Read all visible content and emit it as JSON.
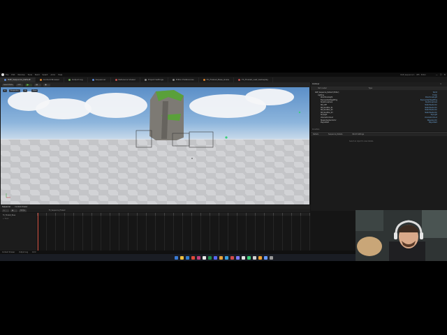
{
  "window": {
    "menu": [
      "File",
      "Edit",
      "Window",
      "Tools",
      "Build",
      "Select",
      "Actor",
      "Help"
    ],
    "title_right": "DAE_Sequence 1 · UE5 · Editor",
    "controls": [
      "—",
      "☐",
      "✕"
    ]
  },
  "tabs": [
    {
      "label": "DAE_Sequence_Default",
      "icon": "level-icon",
      "color": "#5c8ad8",
      "active": true
    },
    {
      "label": "Content Browser",
      "icon": "folder-icon",
      "color": "#d9822b",
      "active": false
    },
    {
      "label": "Output Log",
      "icon": "log-icon",
      "color": "#6aa84f",
      "active": false
    },
    {
      "label": "Sequencer",
      "icon": "film-icon",
      "color": "#5c8ad8",
      "active": false
    },
    {
      "label": "Reference Viewer",
      "icon": "graph-icon",
      "color": "#c0504d",
      "active": false
    },
    {
      "label": "Project Settings",
      "icon": "gear-icon",
      "color": "#888888",
      "active": false
    },
    {
      "label": "Editor Preferences",
      "icon": "gear-icon",
      "color": "#888888",
      "active": false
    },
    {
      "label": "FX_Fireball_Base_Grass",
      "icon": "niagara-icon",
      "color": "#d9822b",
      "active": false
    },
    {
      "label": "FX_Fireball_Leaf_Gameplay",
      "icon": "niagara-icon",
      "color": "#c0504d",
      "active": false
    }
  ],
  "toolbar": {
    "items": [
      "Select Mode",
      "Add",
      "Perspective",
      "Lit",
      "Show"
    ],
    "play_icon": "play-icon"
  },
  "viewport": {
    "overlay_left": "Perspective",
    "overlay_mid": "Lit",
    "overlay_right": "Show"
  },
  "outliner": {
    "title": "Outliner",
    "search_placeholder": "Search...",
    "col_label": "Item Label",
    "col_type": "Type",
    "rows": [
      {
        "label": "DAE_Sequence_Default (Editor)",
        "type": "World"
      },
      {
        "label": "Lighting",
        "type": "Folder"
      },
      {
        "label": "DirectionalLight",
        "type": "DirectionalLight"
      },
      {
        "label": "ExponentialHeightFog",
        "type": "ExponentialHeightFog"
      },
      {
        "label": "SkyAtmosphere",
        "type": "SkyAtmosphere"
      },
      {
        "label": "SM_Cliff",
        "type": "StaticMeshActor"
      },
      {
        "label": "SM_RockBox_01",
        "type": "StaticMeshActor"
      },
      {
        "label": "SM_RockBox_02",
        "type": "StaticMeshActor"
      },
      {
        "label": "SM_RockBox_03",
        "type": "StaticMeshActor"
      },
      {
        "label": "SkyLight",
        "type": "SkyLight"
      },
      {
        "label": "VolumetricCloud",
        "type": "VolumetricCloud"
      },
      {
        "label": "NiagaraSystemActor",
        "type": "NiagaraActor"
      },
      {
        "label": "PlayerStart",
        "type": "PlayerStart"
      }
    ],
    "footer": "14 actors"
  },
  "details": {
    "tabs": [
      "Details",
      "Sequence_Details",
      "World Settings"
    ],
    "empty": "Select an object to view details."
  },
  "sequencer": {
    "tabs": [
      "Sequencer",
      "Content Drawer"
    ],
    "breadcrumb": "FX_Sequence_Fireball",
    "tracks": [
      "FX_Fireball_Base",
      "+ Track"
    ],
    "fps": "30 fps",
    "time": "0000"
  },
  "statusbar": [
    "Content Drawer",
    "Output Log",
    "Cmd"
  ],
  "taskbar": {
    "colors": [
      "#3a7bd5",
      "#f0c040",
      "#2f7bd0",
      "#e04a3a",
      "#c43e7b",
      "#e8e8e8",
      "#1f8f4f",
      "#5865f2",
      "#e8a23a",
      "#3aa0e0",
      "#d24b4b",
      "#7a7aff",
      "#e0e0e0",
      "#3ad07a",
      "#d0d0d0",
      "#f0a030",
      "#6699ff",
      "#999999"
    ]
  },
  "tray": {
    "time": "1:47 PM",
    "date": "3/12/2024"
  }
}
